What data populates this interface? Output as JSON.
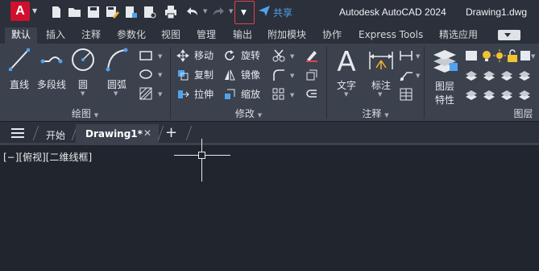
{
  "app": {
    "logo": "A",
    "title": "Autodesk AutoCAD 2024",
    "document": "Drawing1.dwg"
  },
  "qat": {
    "share_label": "共享",
    "icons": [
      "new-icon",
      "open-icon",
      "save-icon",
      "save-as-icon",
      "publish-icon",
      "plot-icon",
      "undo-icon",
      "redo-icon"
    ]
  },
  "tabs": [
    "默认",
    "插入",
    "注释",
    "参数化",
    "视图",
    "管理",
    "输出",
    "附加模块",
    "协作",
    "Express Tools",
    "精选应用"
  ],
  "ribbon": {
    "draw": {
      "title": "绘图",
      "line": "直线",
      "polyline": "多段线",
      "circle": "圆",
      "arc": "圆弧"
    },
    "modify": {
      "title": "修改",
      "move": "移动",
      "rotate": "旋转",
      "copy": "复制",
      "mirror": "镜像",
      "stretch": "拉伸",
      "scale": "缩放"
    },
    "annotation": {
      "title": "注释",
      "text": "文字",
      "dimension": "标注"
    },
    "layers": {
      "title": "图层",
      "props_line1": "图层",
      "props_line2": "特性"
    }
  },
  "file_tabs": {
    "start": "开始",
    "drawing": "Drawing1*",
    "close": "✕",
    "new": "+"
  },
  "viewport": {
    "label": "[−][俯视][二维线框]"
  },
  "colors": {
    "accent_red": "#d0102d",
    "share_blue": "#4fa3ee",
    "highlight": "#e0434f"
  }
}
